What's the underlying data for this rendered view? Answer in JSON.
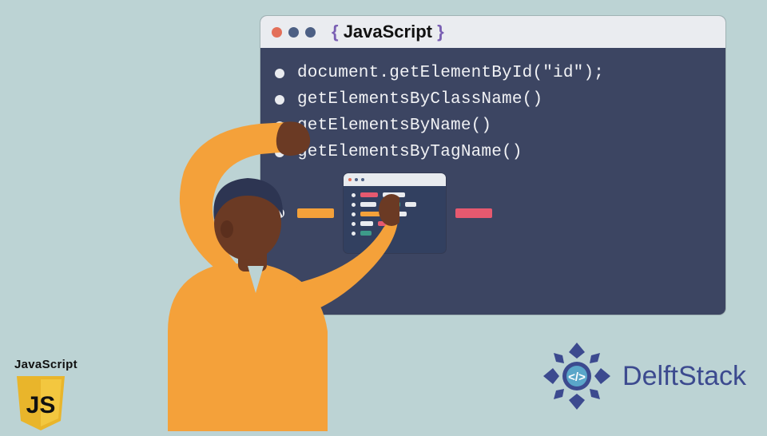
{
  "editor": {
    "title_plain": "JavaScript",
    "lines": [
      "document.getElementById(\"id\");",
      "getElementsByClassName()",
      "getElementsByName()",
      "getElementsByTagName()"
    ]
  },
  "js_logo": {
    "label": "JavaScript",
    "badge_text": "JS"
  },
  "delftstack": {
    "text": "DelftStack"
  },
  "colors": {
    "bg": "#bcd3d4",
    "panel": "#3c4562",
    "orange": "#f4a13a",
    "pink": "#e6596f",
    "teal": "#3d9b89",
    "brand": "#3c4a8f"
  }
}
